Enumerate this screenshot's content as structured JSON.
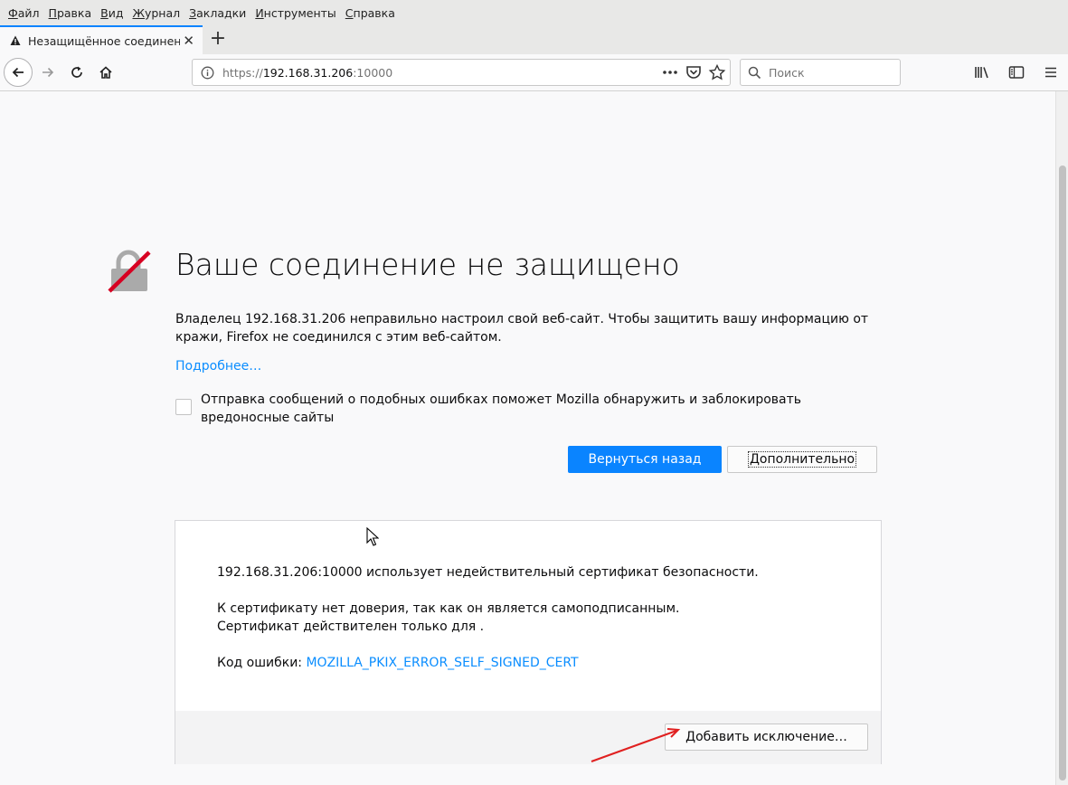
{
  "menu": [
    "Файл",
    "Правка",
    "Вид",
    "Журнал",
    "Закладки",
    "Инструменты",
    "Справка"
  ],
  "tab": {
    "title": "Незащищённое соединение"
  },
  "url": {
    "scheme": "https://",
    "host": "192.168.31.206",
    "port": ":10000"
  },
  "search": {
    "placeholder": "Поиск"
  },
  "error": {
    "title": "Ваше соединение не защищено",
    "description": "Владелец 192.168.31.206 неправильно настроил свой веб-сайт. Чтобы защитить вашу информацию от кражи, Firefox не соединился с этим веб-сайтом.",
    "learn_more": "Подробнее…",
    "report_label": "Отправка сообщений о подобных ошибках поможет Mozilla обнаружить и заблокировать вредоносные сайты",
    "back_button": "Вернуться назад",
    "advanced_button": "Дополнительно"
  },
  "details": {
    "line1": "192.168.31.206:10000 использует недействительный сертификат безопасности.",
    "line2": "К сертификату нет доверия, так как он является самоподписанным.",
    "line3": "Сертификат действителен только для .",
    "code_label": "Код ошибки: ",
    "code_value": "MOZILLA_PKIX_ERROR_SELF_SIGNED_CERT",
    "add_exception": "Добавить исключение…"
  },
  "colors": {
    "accent": "#0a84ff",
    "link": "#0a8dff",
    "annotation": "#e02020"
  }
}
